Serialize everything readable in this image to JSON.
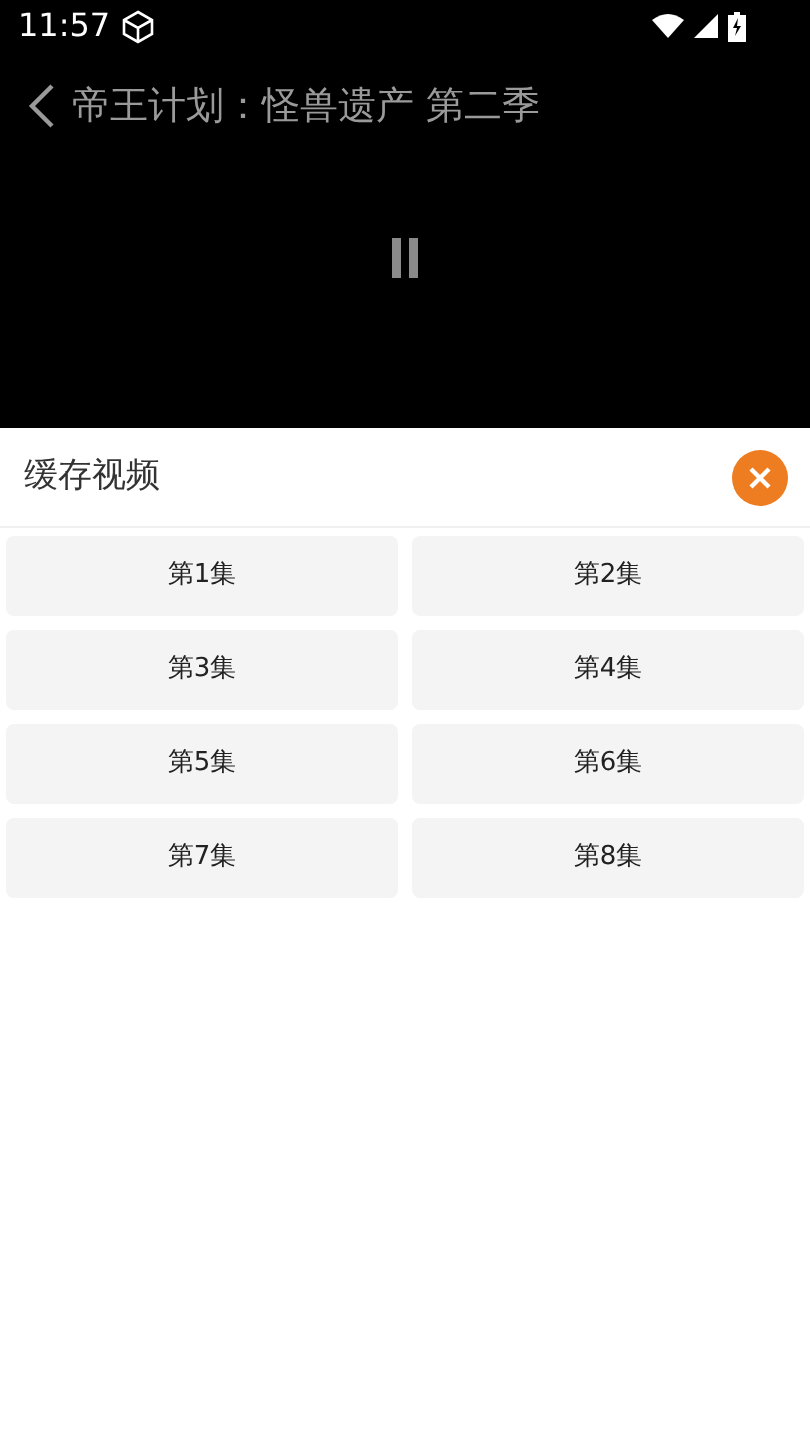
{
  "status_bar": {
    "time": "11:57"
  },
  "player": {
    "title": "帝王计划：怪兽遗产 第二季",
    "paused": true
  },
  "sheet": {
    "title": "缓存视频",
    "episodes": [
      {
        "label": "第1集"
      },
      {
        "label": "第2集"
      },
      {
        "label": "第3集"
      },
      {
        "label": "第4集"
      },
      {
        "label": "第5集"
      },
      {
        "label": "第6集"
      },
      {
        "label": "第7集"
      },
      {
        "label": "第8集"
      }
    ]
  }
}
